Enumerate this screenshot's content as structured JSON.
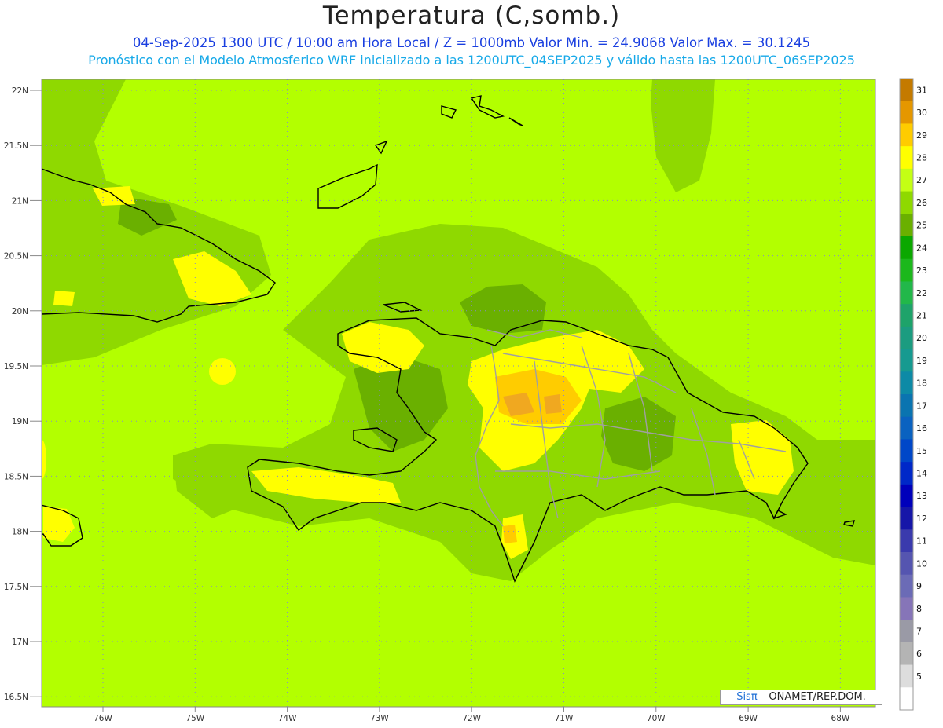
{
  "title": "Temperatura (C,somb.)",
  "subtitle1": "04-Sep-2025 1300 UTC / 10:00 am Hora Local / Z = 1000mb  Valor Min. = 24.9068  Valor Max. = 30.1245",
  "subtitle2": "Pronóstico con el Modelo Atmosferico WRF inicializado a las 1200UTC_04SEP2025 y válido hasta las  1200UTC_06SEP2025",
  "lat_labels": [
    "22N",
    "21.5N",
    "21N",
    "20.5N",
    "20N",
    "19.5N",
    "19N",
    "18.5N",
    "18N",
    "17.5N",
    "17N",
    "16.5N"
  ],
  "lon_labels": [
    "76W",
    "75W",
    "74W",
    "73W",
    "72W",
    "71W",
    "70W",
    "69W",
    "68W"
  ],
  "colorbar": {
    "levels": [
      "31",
      "30",
      "29",
      "28",
      "27",
      "26",
      "25",
      "24",
      "23",
      "22",
      "21",
      "20",
      "19",
      "18",
      "17",
      "16",
      "15",
      "14",
      "13",
      "12",
      "11",
      "10",
      "9",
      "8",
      "7",
      "6",
      "5"
    ],
    "colors": [
      "#c47a00",
      "#e59700",
      "#ffcc00",
      "#ffff00",
      "#c4ff14",
      "#8fd900",
      "#6ab000",
      "#0ba800",
      "#1cb81c",
      "#22b84a",
      "#1ea36a",
      "#1b9c80",
      "#169a90",
      "#0d8aa6",
      "#0a74b0",
      "#0a62c0",
      "#0047c8",
      "#0028c8",
      "#0000bb",
      "#1616a8",
      "#3a3aad",
      "#5555b0",
      "#6b6bb6",
      "#8675b8",
      "#9a9aa6",
      "#b4b4b4",
      "#dddddd",
      "#ffffff"
    ]
  },
  "colors": {
    "background": "#b3ff00",
    "shade_dark": "#8fd900",
    "shade_darker": "#6ab000",
    "warm": "#ffff00",
    "hot": "#ffcc00",
    "hottest": "#f0a820",
    "grid": "#8888cc",
    "coast": "#000000",
    "borders": "#a0a0a0"
  },
  "credit": {
    "sis": "Sisπ",
    "rest": " – ONAMET/REP.DOM."
  }
}
